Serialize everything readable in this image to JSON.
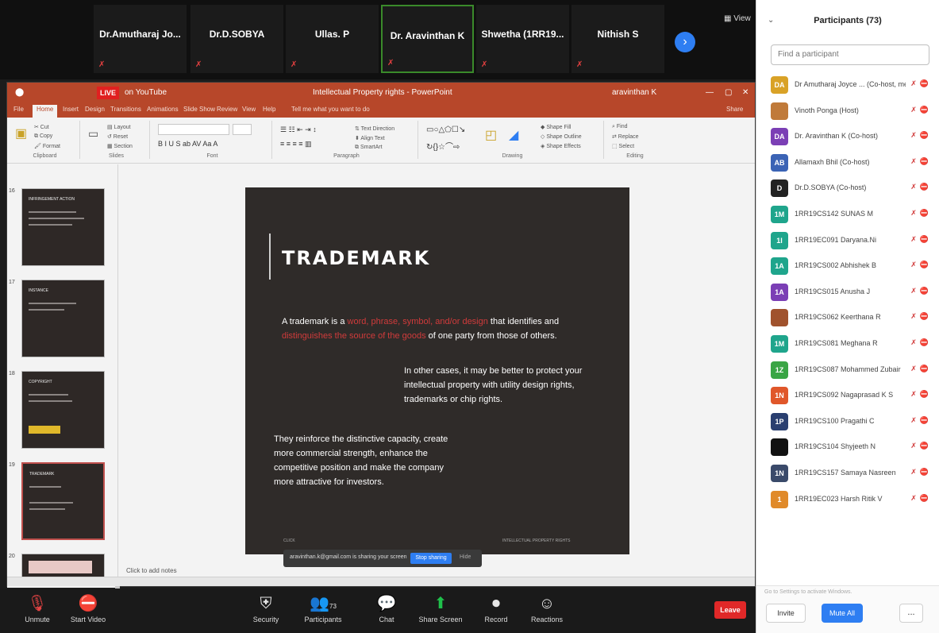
{
  "colors": {
    "ppt_red": "#b7472a",
    "zoom_blue": "#2e7ef2",
    "mute_red": "#d13b3b",
    "slide_bg": "#2f2b29"
  },
  "video_strip": {
    "tiles": [
      {
        "name": "Dr.Amutharaj Jo..."
      },
      {
        "name": "Dr.D.SOBYA"
      },
      {
        "name": "Ullas. P"
      },
      {
        "name": "Dr. Aravinthan K"
      },
      {
        "name": "Shwetha (1RR19..."
      },
      {
        "name": "Nithish S"
      }
    ],
    "view_label": "View"
  },
  "powerpoint": {
    "title": "Intellectual Property rights - PowerPoint",
    "user": "aravinthan K",
    "live_label": "LIVE",
    "live_target": "on YouTube",
    "tabs": [
      "File",
      "Home",
      "Insert",
      "Design",
      "Transitions",
      "Animations",
      "Slide Show",
      "Review",
      "View",
      "Help",
      "Tell me what you want to do"
    ],
    "share_label": "Share",
    "ribbon_groups": [
      "Clipboard",
      "Slides",
      "Font",
      "Paragraph",
      "Drawing",
      "Editing"
    ],
    "thumb_numbers": [
      "16",
      "17",
      "18",
      "19",
      "20"
    ],
    "thumb_titles": [
      "INFRINGEMENT ACTION",
      "INSTANCE",
      "COPYRIGHT",
      "TRADEMARK",
      ""
    ],
    "notes_placeholder": "Click to add notes"
  },
  "slide": {
    "title": "TRADEMARK",
    "p1_pre": "A trademark is a ",
    "p1_red": "word, phrase, symbol, and/or design",
    "p1_mid": " that identifies and ",
    "p1_red2": "distinguishes the source of the goods",
    "p1_post": " of one party from those of others.",
    "p2": "In other cases, it may be better to protect your intellectual property with utility design rights, trademarks or chip rights.",
    "p3": "They reinforce the distinctive capacity, create more commercial strength, enhance the competitive position and make the company more attractive for investors.",
    "footer_left": "CLICK",
    "footer_right": "INTELLECTUAL PROPERTY RIGHTS"
  },
  "share_banner": {
    "text": "aravinthan.k@gmail.com is sharing your screen",
    "stop_label": "Stop sharing",
    "hide_label": "Hide"
  },
  "controls": {
    "unmute": "Unmute",
    "start_video": "Start Video",
    "security": "Security",
    "participants": "Participants",
    "participant_count": "73",
    "chat": "Chat",
    "share_screen": "Share Screen",
    "record": "Record",
    "reactions": "Reactions",
    "leave": "Leave"
  },
  "panel": {
    "title": "Participants (73)",
    "search_placeholder": "Find a participant",
    "participants": [
      {
        "initials": "DA",
        "color": "#d9a227",
        "name": "Dr Amutharaj Joyce ... (Co-host, me)"
      },
      {
        "initials": "",
        "color": "#c07a3a",
        "name": "Vinoth Ponga (Host)"
      },
      {
        "initials": "DA",
        "color": "#7b3fb5",
        "name": "Dr. Aravinthan K (Co-host)"
      },
      {
        "initials": "AB",
        "color": "#3b63b5",
        "name": "Allamaxh Bhil (Co-host)"
      },
      {
        "initials": "D",
        "color": "#222222",
        "name": "Dr.D.SOBYA (Co-host)"
      },
      {
        "initials": "1M",
        "color": "#1fa58c",
        "name": "1RR19CS142 SUNAS M"
      },
      {
        "initials": "1I",
        "color": "#1fa58c",
        "name": "1RR19EC091 Daryana.Ni"
      },
      {
        "initials": "1A",
        "color": "#1fa58c",
        "name": "1RR19CS002 Abhishek B"
      },
      {
        "initials": "1A",
        "color": "#7b3fb5",
        "name": "1RR19CS015 Anusha J"
      },
      {
        "initials": "",
        "color": "#a0522d",
        "name": "1RR19CS062 Keerthana R"
      },
      {
        "initials": "1M",
        "color": "#1fa58c",
        "name": "1RR19CS081 Meghana R"
      },
      {
        "initials": "1Z",
        "color": "#3aa545",
        "name": "1RR19CS087 Mohammed Zubair"
      },
      {
        "initials": "1N",
        "color": "#e0572a",
        "name": "1RR19CS092 Nagaprasad K S"
      },
      {
        "initials": "1P",
        "color": "#2a3f70",
        "name": "1RR19CS100 Pragathi C"
      },
      {
        "initials": "",
        "color": "#111111",
        "name": "1RR19CS104 Shyjeeth N"
      },
      {
        "initials": "1N",
        "color": "#3a4a6a",
        "name": "1RR19CS157 Samaya Nasreen"
      },
      {
        "initials": "1",
        "color": "#e08a2a",
        "name": "1RR19EC023 Harsh Ritik V"
      }
    ],
    "footer_note": "Go to Settings to activate Windows.",
    "invite": "Invite",
    "mute_all": "Mute All",
    "more": "..."
  }
}
